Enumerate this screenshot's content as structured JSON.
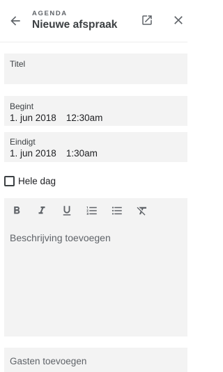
{
  "header": {
    "app_label": "AGENDA",
    "title": "Nieuwe afspraak",
    "icons": [
      "arrow-back-icon",
      "open-in-new-icon",
      "close-icon"
    ]
  },
  "form": {
    "title_label": "Titel",
    "start": {
      "label": "Begint",
      "date": "1. jun 2018",
      "time": "12:30am"
    },
    "end": {
      "label": "Eindigt",
      "date": "1. jun 2018",
      "time": "1:30am"
    },
    "all_day": {
      "label": "Hele dag",
      "checked": false
    }
  },
  "editor": {
    "toolbar_icons": [
      "bold-icon",
      "italic-icon",
      "underline-icon",
      "numbered-list-icon",
      "bulleted-list-icon",
      "clear-formatting-icon"
    ],
    "placeholder": "Beschrijving toevoegen"
  },
  "guests": {
    "placeholder": "Gasten toevoegen"
  },
  "colors": {
    "field_bg": "#f3f3f3",
    "icon": "#5f6368",
    "text": "#202124"
  }
}
